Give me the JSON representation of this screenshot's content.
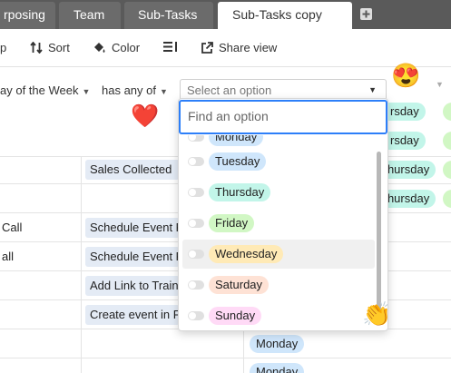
{
  "tabs": [
    {
      "label": "rposing",
      "active": false
    },
    {
      "label": "Team",
      "active": false
    },
    {
      "label": "Sub-Tasks",
      "active": false
    },
    {
      "label": "Sub-Tasks copy",
      "active": true
    }
  ],
  "toolbar": {
    "group_label": "p",
    "sort_label": "Sort",
    "color_label": "Color",
    "share_label": "Share view"
  },
  "filter": {
    "field_label": "ay of the Week",
    "operator_label": "has any of",
    "select_placeholder": "Select an option"
  },
  "dropdown": {
    "search_placeholder": "Find an option",
    "options": [
      {
        "label": "Monday",
        "color": "#cfe6fb"
      },
      {
        "label": "Tuesday",
        "color": "#cfe6fb"
      },
      {
        "label": "Thursday",
        "color": "#c2f5e9"
      },
      {
        "label": "Friday",
        "color": "#d1f7c4"
      },
      {
        "label": "Wednesday",
        "color": "#ffeab6"
      },
      {
        "label": "Saturday",
        "color": "#fee2d5"
      },
      {
        "label": "Sunday",
        "color": "#ffdaf6"
      }
    ]
  },
  "grid": {
    "col1": [
      "Call",
      "all"
    ],
    "col2": [
      "Sales Collected",
      "Schedule Event F",
      "Schedule Event F",
      "Add Link to Train",
      "Create event in F"
    ],
    "right_chips": [
      "rsday",
      "rsday",
      "Thursday",
      "Thursday"
    ],
    "bottom_chips": [
      "Monday",
      "Monday"
    ]
  },
  "colors": {
    "accent": "#2d7ff9",
    "thursday": "#c2f5e9",
    "monday": "#cfe6fb",
    "green": "#d1f7c4"
  },
  "emojis": {
    "heart_eyes": "😍",
    "heart": "❤️",
    "clap": "👏"
  }
}
